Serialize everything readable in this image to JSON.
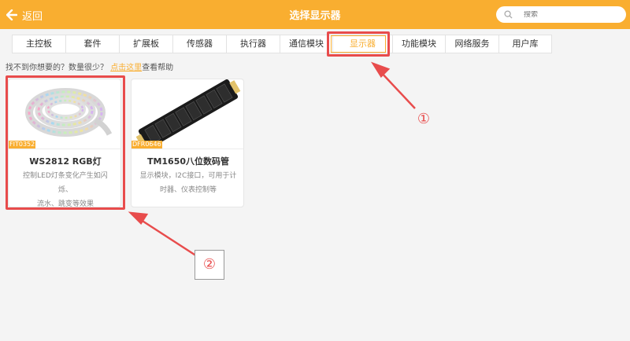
{
  "header": {
    "back_label": "返回",
    "title": "选择显示器",
    "search_placeholder": "搜索",
    "accent_color": "#f9ae30"
  },
  "tabs": [
    {
      "label": "主控板",
      "active": false
    },
    {
      "label": "套件",
      "active": false
    },
    {
      "label": "扩展板",
      "active": false
    },
    {
      "label": "传感器",
      "active": false
    },
    {
      "label": "执行器",
      "active": false
    },
    {
      "label": "通信模块",
      "active": false
    },
    {
      "label": "显示器",
      "active": true
    },
    {
      "label": "功能模块",
      "active": false
    },
    {
      "label": "网络服务",
      "active": false
    },
    {
      "label": "用户库",
      "active": false
    }
  ],
  "hint": {
    "prefix": "找不到你想要的？数量很少？",
    "link": "点击这里",
    "suffix": "查看帮助"
  },
  "cards": [
    {
      "code": "FIT0352",
      "name": "WS2812 RGB灯",
      "desc_line1": "控制LED灯条变化产生如闪烁、",
      "desc_line2": "流水、跳变等效果"
    },
    {
      "code": "DFR0646",
      "name": "TM1650八位数码管",
      "desc_line1": "显示模块，I2C接口，可用于计",
      "desc_line2": "时器、仪表控制等"
    }
  ],
  "annotations": {
    "marker_1": "①",
    "marker_2": "②",
    "color": "#e84c4c"
  }
}
